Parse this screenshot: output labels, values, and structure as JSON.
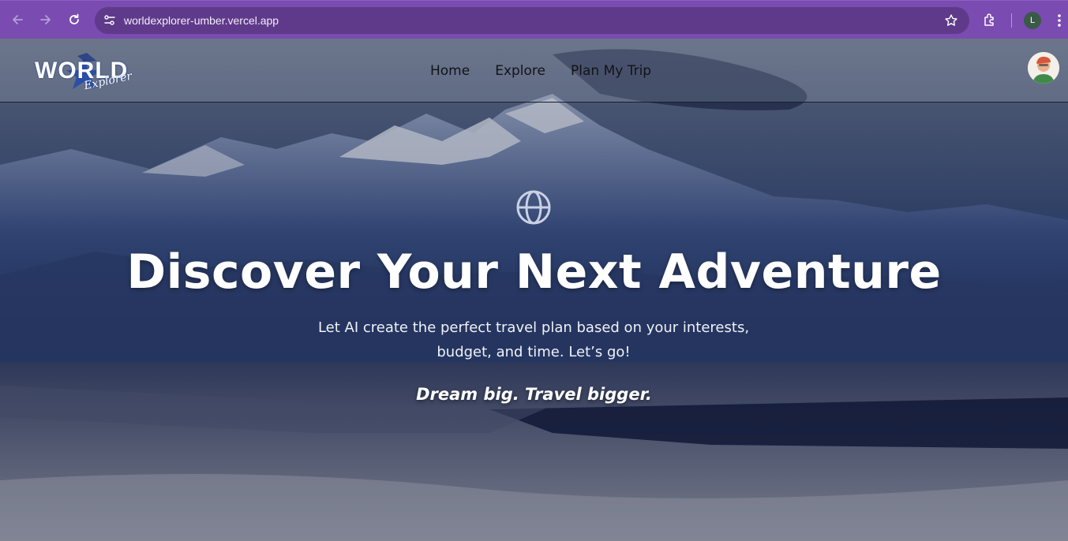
{
  "browser": {
    "url": "worldexplorer-umber.vercel.app",
    "profile_initial": "L",
    "chrome_color": "#7a4bb0",
    "omnibox_color": "#5f3a8a",
    "icons": {
      "back": "arrow-left-icon",
      "forward": "arrow-right-icon",
      "reload": "reload-icon",
      "site_info": "tune-icon",
      "bookmark": "star-icon",
      "extensions": "puzzle-icon",
      "menu": "kebab-menu-icon"
    }
  },
  "site": {
    "logo_word": "WORLD",
    "logo_script": "Explorer",
    "nav": [
      "Home",
      "Explore",
      "Plan My Trip"
    ],
    "avatar_icon": "user-avatar"
  },
  "hero": {
    "icon": "globe-icon",
    "title": "Discover Your Next Adventure",
    "subtitle_line1": "Let AI create the perfect travel plan based on your interests,",
    "subtitle_line2": "budget, and time. Let’s go!",
    "tagline": "Dream big. Travel bigger."
  }
}
